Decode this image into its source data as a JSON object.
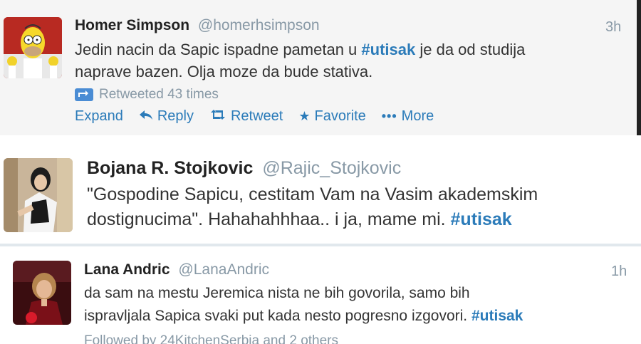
{
  "tweets": [
    {
      "name": "Homer Simpson",
      "handle": "@homerhsimpson",
      "time": "3h",
      "text_parts": [
        "Jedin nacin da Sapic ispadne pametan u ",
        "#utisak",
        " je da od studija",
        "naprave bazen. Olja moze da bude stativa."
      ],
      "retweet_info": "Retweeted 43 times",
      "actions": {
        "expand": "Expand",
        "reply": "Reply",
        "retweet": "Retweet",
        "favorite": "Favorite",
        "more": "More"
      }
    },
    {
      "name": "Bojana R. Stojkovic",
      "handle": "@Rajic_Stojkovic",
      "text_parts": [
        "\"Gospodine Sapicu, cestitam Vam na Vasim akademskim",
        "dostignucima\". Hahahahhhaa.. i ja, mame mi. ",
        "#utisak"
      ]
    },
    {
      "name": "Lana Andric",
      "handle": "@LanaAndric",
      "time": "1h",
      "text_parts": [
        "da sam na mestu Jeremica nista ne bih govorila, samo bih",
        "ispravljala Sapica svaki put kada nesto pogresno izgovori. ",
        "#utisak"
      ],
      "followed_by": "Followed by 24KitchenSerbia and 2 others"
    }
  ],
  "colors": {
    "link": "#2b7bb9",
    "muted": "#8899a6",
    "text": "#333333"
  },
  "icons": [
    "retweet-badge-icon",
    "reply-arrow-icon",
    "retweet-icon",
    "star-icon",
    "more-dots-icon"
  ]
}
